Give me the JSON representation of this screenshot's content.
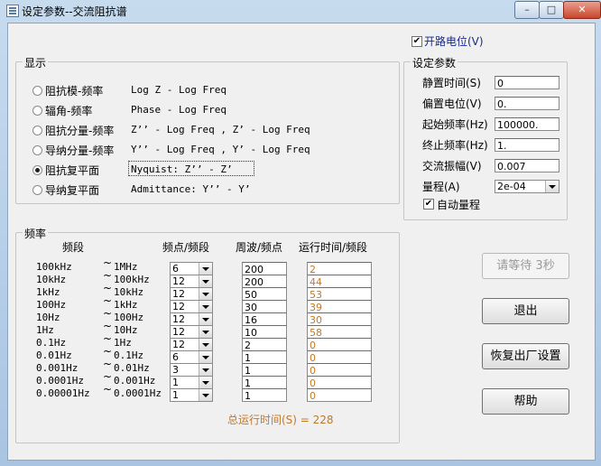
{
  "window": {
    "title": "设定参数--交流阻抗谱",
    "minimize": "–",
    "maximize": "□",
    "close": "✕"
  },
  "open_circuit": {
    "label": "开路电位(V)",
    "checked": true
  },
  "display": {
    "title": "显示",
    "options": [
      {
        "label": "阻抗模-频率",
        "desc": "Log Z - Log Freq",
        "selected": false
      },
      {
        "label": "辐角-频率",
        "desc": "Phase - Log Freq",
        "selected": false
      },
      {
        "label": "阻抗分量-频率",
        "desc": "Z’’ - Log Freq , Z’ - Log Freq",
        "selected": false
      },
      {
        "label": "导纳分量-频率",
        "desc": "Y’’ - Log Freq , Y’ - Log Freq",
        "selected": false
      },
      {
        "label": "阻抗复平面",
        "desc": "Nyquist:    Z’’ - Z’",
        "selected": true
      },
      {
        "label": "导纳复平面",
        "desc": "Admittance: Y’’ - Y’",
        "selected": false
      }
    ]
  },
  "params": {
    "title": "设定参数",
    "fields": [
      {
        "label": "静置时间(S)",
        "value": "0"
      },
      {
        "label": "偏置电位(V)",
        "value": "0."
      },
      {
        "label": "起始频率(Hz)",
        "value": "100000."
      },
      {
        "label": "终止频率(Hz)",
        "value": "1."
      },
      {
        "label": "交流振幅(V)",
        "value": "0.007"
      }
    ],
    "range_label": "量程(A)",
    "range_value": "2e-04",
    "auto_range": {
      "label": "自动量程",
      "checked": true
    }
  },
  "freq": {
    "title": "频率",
    "headers": {
      "band": "频段",
      "points": "频点/频段",
      "cycles": "周波/频点",
      "time": "运行时间/频段"
    },
    "tilde": "~",
    "rows": [
      {
        "from": "100kHz",
        "to": "1MHz",
        "points": "6",
        "cycles": "200",
        "time": "2"
      },
      {
        "from": "10kHz",
        "to": "100kHz",
        "points": "12",
        "cycles": "200",
        "time": "44"
      },
      {
        "from": "1kHz",
        "to": "10kHz",
        "points": "12",
        "cycles": "50",
        "time": "53"
      },
      {
        "from": "100Hz",
        "to": "1kHz",
        "points": "12",
        "cycles": "30",
        "time": "39"
      },
      {
        "from": "10Hz",
        "to": "100Hz",
        "points": "12",
        "cycles": "16",
        "time": "30"
      },
      {
        "from": "1Hz",
        "to": "10Hz",
        "points": "12",
        "cycles": "10",
        "time": "58"
      },
      {
        "from": "0.1Hz",
        "to": "1Hz",
        "points": "12",
        "cycles": "2",
        "time": "0"
      },
      {
        "from": "0.01Hz",
        "to": "0.1Hz",
        "points": "6",
        "cycles": "1",
        "time": "0"
      },
      {
        "from": "0.001Hz",
        "to": "0.01Hz",
        "points": "3",
        "cycles": "1",
        "time": "0"
      },
      {
        "from": "0.0001Hz",
        "to": "0.001Hz",
        "points": "1",
        "cycles": "1",
        "time": "0"
      },
      {
        "from": "0.00001Hz",
        "to": "0.0001Hz",
        "points": "1",
        "cycles": "1",
        "time": "0"
      }
    ],
    "total": "总运行时间(S) = 228"
  },
  "buttons": {
    "wait": "请等待 3秒",
    "exit": "退出",
    "restore": "恢复出厂设置",
    "help": "帮助"
  },
  "colors": {
    "accent_text": "#c07a2a",
    "link_blue": "#1a2a8a"
  }
}
